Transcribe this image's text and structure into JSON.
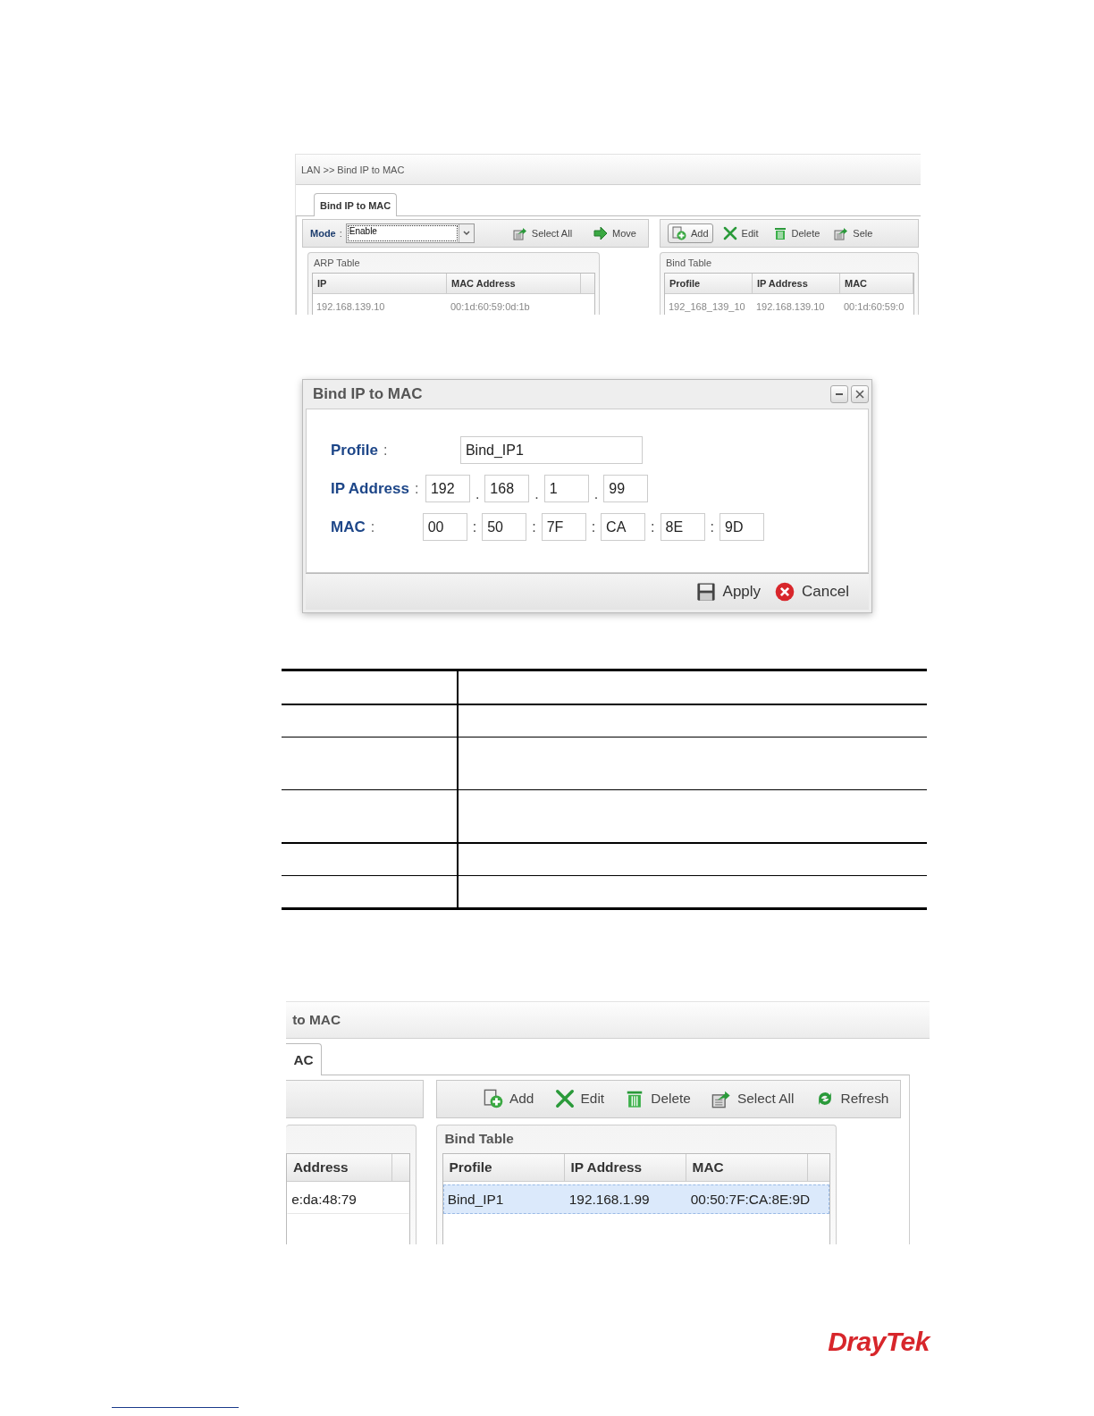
{
  "top_screenshot": {
    "breadcrumb": "LAN >> Bind IP to MAC",
    "tabs": [
      {
        "label": "Bind IP to MAC",
        "selected": true
      }
    ],
    "mode": {
      "label": "Mode",
      "separator": ":",
      "value": "Enable"
    },
    "left_actions": [
      {
        "kind": "select_all",
        "label": "Select All"
      },
      {
        "kind": "move",
        "label": "Move"
      }
    ],
    "arp_table": {
      "title": "ARP Table",
      "columns": [
        "IP",
        "MAC Address"
      ],
      "rows": [
        {
          "cells": [
            "192.168.139.10",
            "00:1d:60:59:0d:1b"
          ],
          "selected": false
        }
      ]
    },
    "right_actions": [
      {
        "kind": "add",
        "label": "Add",
        "pressed": true
      },
      {
        "kind": "edit",
        "label": "Edit",
        "pressed": false
      },
      {
        "kind": "delete",
        "label": "Delete",
        "pressed": false
      },
      {
        "kind": "select_all",
        "label": "Sele",
        "pressed": false
      }
    ],
    "bind_table": {
      "title": "Bind Table",
      "columns": [
        "Profile",
        "IP Address",
        "MAC"
      ],
      "rows": [
        {
          "cells": [
            "192_168_139_10",
            "192.168.139.10",
            "00:1d:60:59:0"
          ],
          "selected": false
        }
      ]
    }
  },
  "dialog": {
    "title": "Bind IP to MAC",
    "profile": {
      "label": "Profile",
      "separator": ":",
      "value": "Bind_IP1"
    },
    "ip_address": {
      "label": "IP Address",
      "separator": ":",
      "joiner": ".",
      "parts": [
        "192",
        "168",
        "1",
        "99"
      ]
    },
    "mac": {
      "label": "MAC",
      "separator": ":",
      "joiner": ":",
      "parts": [
        "00",
        "50",
        "7F",
        "CA",
        "8E",
        "9D"
      ]
    },
    "buttons": [
      {
        "kind": "apply",
        "label": "Apply"
      },
      {
        "kind": "cancel",
        "label": "Cancel"
      }
    ]
  },
  "bottom_screenshot": {
    "title": "to MAC",
    "tabs": [
      {
        "label": "AC",
        "selected": true
      }
    ],
    "arp_table": {
      "columns": [
        "Address"
      ],
      "rows": [
        {
          "cells": [
            "e:da:48:79"
          ],
          "selected": false
        }
      ]
    },
    "right_actions": [
      {
        "kind": "add",
        "label": "Add",
        "pressed": false
      },
      {
        "kind": "edit",
        "label": "Edit",
        "pressed": false
      },
      {
        "kind": "delete",
        "label": "Delete",
        "pressed": false
      },
      {
        "kind": "select_all",
        "label": "Select All",
        "pressed": false
      },
      {
        "kind": "refresh",
        "label": "Refresh",
        "pressed": false
      }
    ],
    "bind_table": {
      "title": "Bind Table",
      "columns": [
        "Profile",
        "IP Address",
        "MAC"
      ],
      "rows": [
        {
          "cells": [
            "Bind_IP1",
            "192.168.1.99",
            "00:50:7F:CA:8E:9D"
          ],
          "selected": true
        }
      ]
    }
  },
  "logo": "DrayTek"
}
